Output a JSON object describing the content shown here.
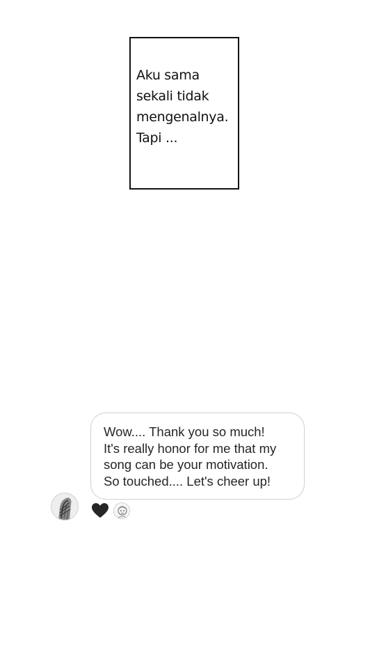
{
  "caption": {
    "lines": [
      "Aku sama",
      "sekali tidak",
      "mengenalnya.",
      "Tapi ..."
    ]
  },
  "message": {
    "lines": [
      "Wow.... Thank you so much!",
      "It's really honor for me that my",
      "song can be your motivation.",
      "So touched.... Let's cheer up!"
    ]
  },
  "icons": {
    "sender_avatar": "avatar",
    "reaction": "heart-icon",
    "reactor_avatar": "avatar"
  },
  "colors": {
    "bubble_border": "#cfcfcf",
    "message_text": "#262626",
    "heart": "#262626"
  }
}
